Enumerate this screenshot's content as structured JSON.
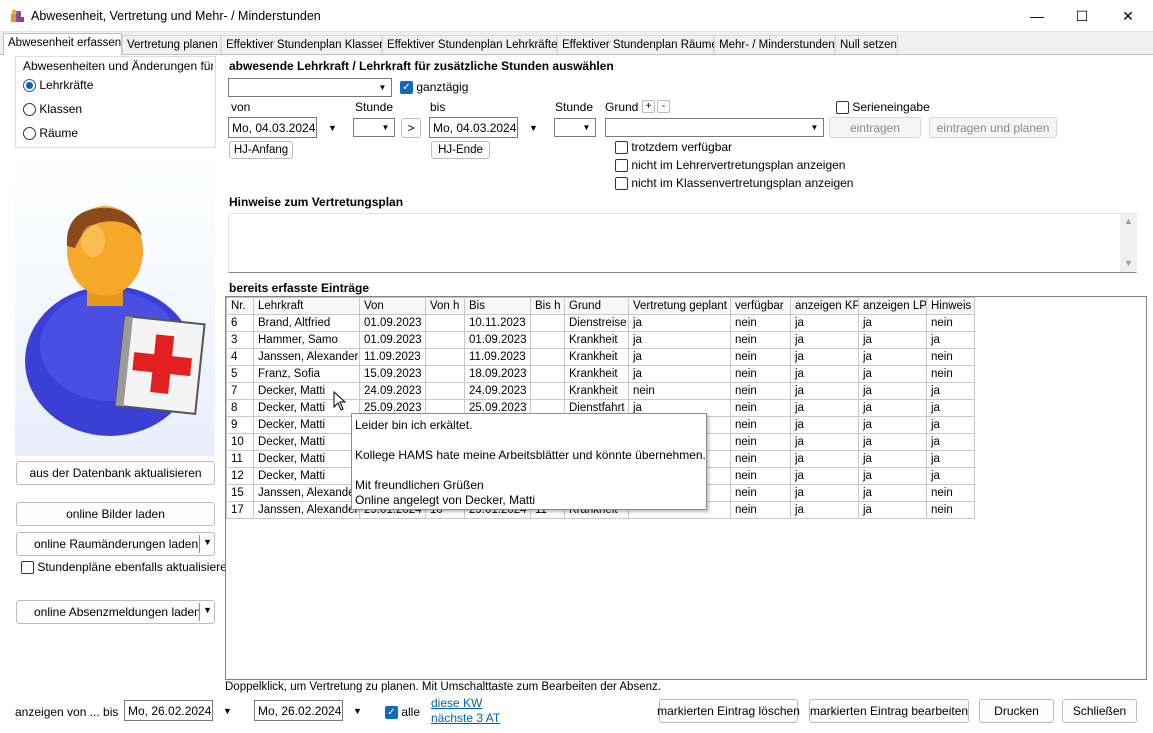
{
  "window": {
    "title": "Abwesenheit, Vertretung und Mehr- / Minderstunden",
    "minimize": "—",
    "maximize": "☐",
    "close": "✕"
  },
  "tabs": [
    "Abwesenheit erfassen",
    "Vertretung planen",
    "Effektiver Stundenplan Klassen",
    "Effektiver Stundenplan Lehrkräfte",
    "Effektiver Stundenplan Räume",
    "Mehr- / Minderstunden",
    "Null setzen"
  ],
  "left": {
    "group_title": "Abwesenheiten und Änderungen für...",
    "radios": [
      {
        "label": "Lehrkräfte",
        "selected": true
      },
      {
        "label": "Klassen",
        "selected": false
      },
      {
        "label": "Räume",
        "selected": false
      }
    ],
    "refresh_db": "aus der Datenbank aktualisieren",
    "load_images": "online Bilder laden",
    "load_room_changes": "online Raumänderungen laden",
    "update_timetables": "Stundenpläne ebenfalls aktualisieren",
    "load_absences": "online Absenzmeldungen laden"
  },
  "form": {
    "heading": "abwesende Lehrkraft / Lehrkraft für zusätzliche Stunden auswählen",
    "teacher_value": "",
    "ganztaegig": "ganztägig",
    "von_label": "von",
    "stunde_label": "Stunde",
    "bis_label": "bis",
    "stunde2_label": "Stunde",
    "grund_label": "Grund",
    "plus": "+",
    "minus": "-",
    "von_date": "Mo, 04.03.2024",
    "bis_date": "Mo, 04.03.2024",
    "arrow_btn": ">",
    "hj_anfang": "HJ-Anfang",
    "hj_ende": "HJ-Ende",
    "serieneingabe": "Serieneingabe",
    "eintragen": "eintragen",
    "eintragen_planen": "eintragen und planen",
    "trotzdem": "trotzdem verfügbar",
    "nicht_lehrer": "nicht im Lehrervertretungsplan anzeigen",
    "nicht_klassen": "nicht im Klassenvertretungsplan anzeigen",
    "hinweise_heading": "Hinweise zum Vertretungsplan",
    "entries_heading": "bereits erfasste Einträge"
  },
  "table": {
    "columns": [
      "Nr.",
      "Lehrkraft",
      "Von",
      "Von h",
      "Bis",
      "Bis h",
      "Grund",
      "Vertretung geplant",
      "verfügbar",
      "anzeigen KP",
      "anzeigen LP",
      "Hinweis"
    ],
    "rows": [
      [
        "6",
        "Brand, Altfried",
        "01.09.2023",
        "",
        "10.11.2023",
        "",
        "Dienstreise",
        "ja",
        "nein",
        "ja",
        "ja",
        "nein"
      ],
      [
        "3",
        "Hammer, Samo",
        "01.09.2023",
        "",
        "01.09.2023",
        "",
        "Krankheit",
        "ja",
        "nein",
        "ja",
        "ja",
        "ja"
      ],
      [
        "4",
        "Janssen, Alexander",
        "11.09.2023",
        "",
        "11.09.2023",
        "",
        "Krankheit",
        "ja",
        "nein",
        "ja",
        "ja",
        "nein"
      ],
      [
        "5",
        "Franz, Sofia",
        "15.09.2023",
        "",
        "18.09.2023",
        "",
        "Krankheit",
        "ja",
        "nein",
        "ja",
        "ja",
        "nein"
      ],
      [
        "7",
        "Decker, Matti",
        "24.09.2023",
        "",
        "24.09.2023",
        "",
        "Krankheit",
        "nein",
        "nein",
        "ja",
        "ja",
        "ja"
      ],
      [
        "8",
        "Decker, Matti",
        "25.09.2023",
        "",
        "25.09.2023",
        "",
        "Dienstfahrt",
        "ja",
        "nein",
        "ja",
        "ja",
        "ja"
      ],
      [
        "9",
        "Decker, Matti",
        "",
        "",
        "",
        "",
        "",
        "",
        "nein",
        "ja",
        "ja",
        "ja"
      ],
      [
        "10",
        "Decker, Matti",
        "",
        "",
        "",
        "",
        "",
        "",
        "nein",
        "ja",
        "ja",
        "ja"
      ],
      [
        "11",
        "Decker, Matti",
        "",
        "",
        "",
        "",
        "",
        "",
        "nein",
        "ja",
        "ja",
        "ja"
      ],
      [
        "12",
        "Decker, Matti",
        "",
        "",
        "",
        "",
        "",
        "",
        "nein",
        "ja",
        "ja",
        "ja"
      ],
      [
        "15",
        "Janssen, Alexander",
        "",
        "",
        "",
        "",
        "",
        "",
        "nein",
        "ja",
        "ja",
        "nein"
      ],
      [
        "17",
        "Janssen, Alexander",
        "29.01.2024",
        "10",
        "29.01.2024",
        "11",
        "Krankheit",
        "",
        "nein",
        "ja",
        "ja",
        "nein"
      ]
    ]
  },
  "tooltip": {
    "lines": [
      "Leider bin ich erkältet.",
      "",
      "Kollege HAMS hate meine Arbeitsblätter und könnte übernehmen.",
      "",
      "Mit freundlichen Grüßen",
      "Online angelegt von Decker, Matti"
    ]
  },
  "bottom": {
    "hint": "Doppelklick, um Vertretung zu planen. Mit Umschalttaste zum Bearbeiten der Absenz.",
    "anzeigen_label": "anzeigen von ... bis",
    "from_date": "Mo, 26.02.2024",
    "to_date": "Mo, 26.02.2024",
    "alle": "alle",
    "diese_kw": "diese KW",
    "naechste": "nächste 3 AT",
    "delete": "markierten Eintrag löschen",
    "edit": "markierten Eintrag bearbeiten",
    "print": "Drucken",
    "close": "Schließen"
  }
}
